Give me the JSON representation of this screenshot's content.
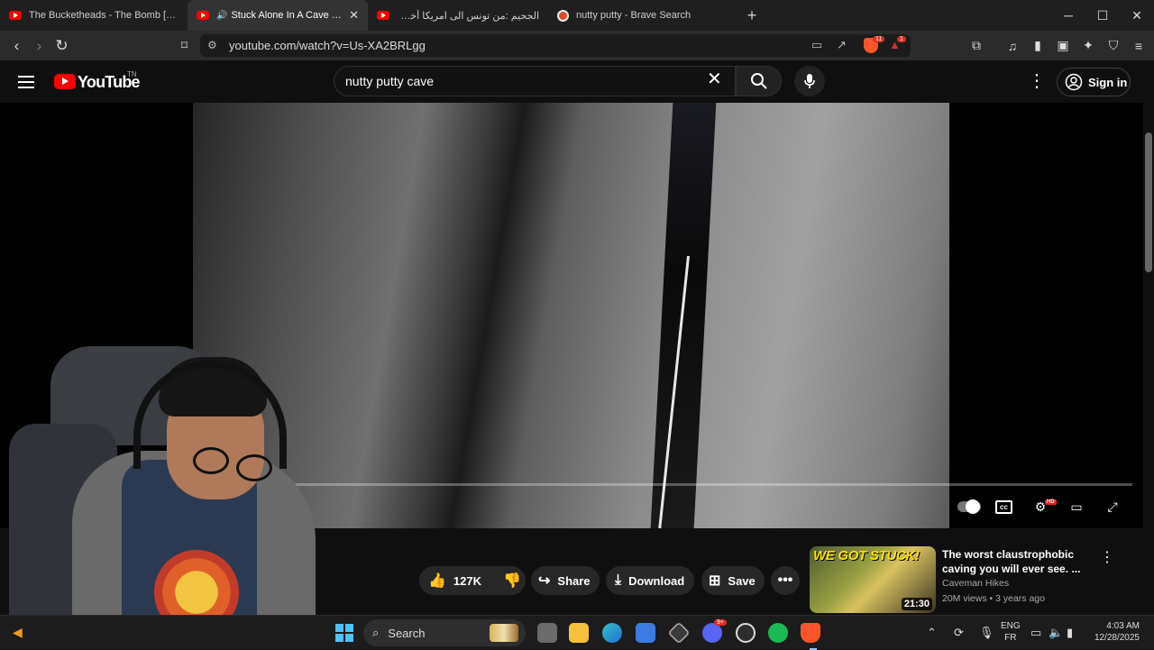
{
  "browser": {
    "tabs": [
      {
        "title": "The Bucketheads - The Bomb [These",
        "favicon": "youtube-icon",
        "active": false
      },
      {
        "title": "Stuck Alone In A Cave - Anxie",
        "favicon": "youtube-icon",
        "active": true,
        "audio": true
      },
      {
        "title": "الجحيم :من تونس الى امريكا أخطر طري",
        "favicon": "youtube-icon",
        "active": false
      },
      {
        "title": "nutty putty - Brave Search",
        "favicon": "brave-icon",
        "active": false
      }
    ],
    "new_tab": "+",
    "window_controls": [
      "─",
      "☐",
      "✕"
    ],
    "url": "youtube.com/watch?v=Us-XA2BRLgg",
    "shield_badge": "11",
    "alert_badge": "1"
  },
  "youtube": {
    "logo_text": "YouTube",
    "logo_region": "TN",
    "search_value": "nutty putty cave",
    "signin_label": "Sign in"
  },
  "actions": {
    "likes": "127K",
    "share": "Share",
    "download": "Download",
    "save": "Save"
  },
  "recommended": {
    "thumb_text": "WE GOT STUCK!",
    "duration": "21:30",
    "title": "The worst claustrophobic caving you will ever see. ...",
    "channel": "Caveman Hikes",
    "meta": "20M views • 3 years ago"
  },
  "taskbar": {
    "search_label": "Search",
    "lang_line1": "ENG",
    "lang_line2": "FR",
    "time": "4:03 AM",
    "date": "12/28/2025",
    "discord_badge": "9+"
  },
  "colors": {
    "youtube_red": "#ff0000",
    "background": "#0f0f0f",
    "windows_blue": "#4cc2ff"
  }
}
